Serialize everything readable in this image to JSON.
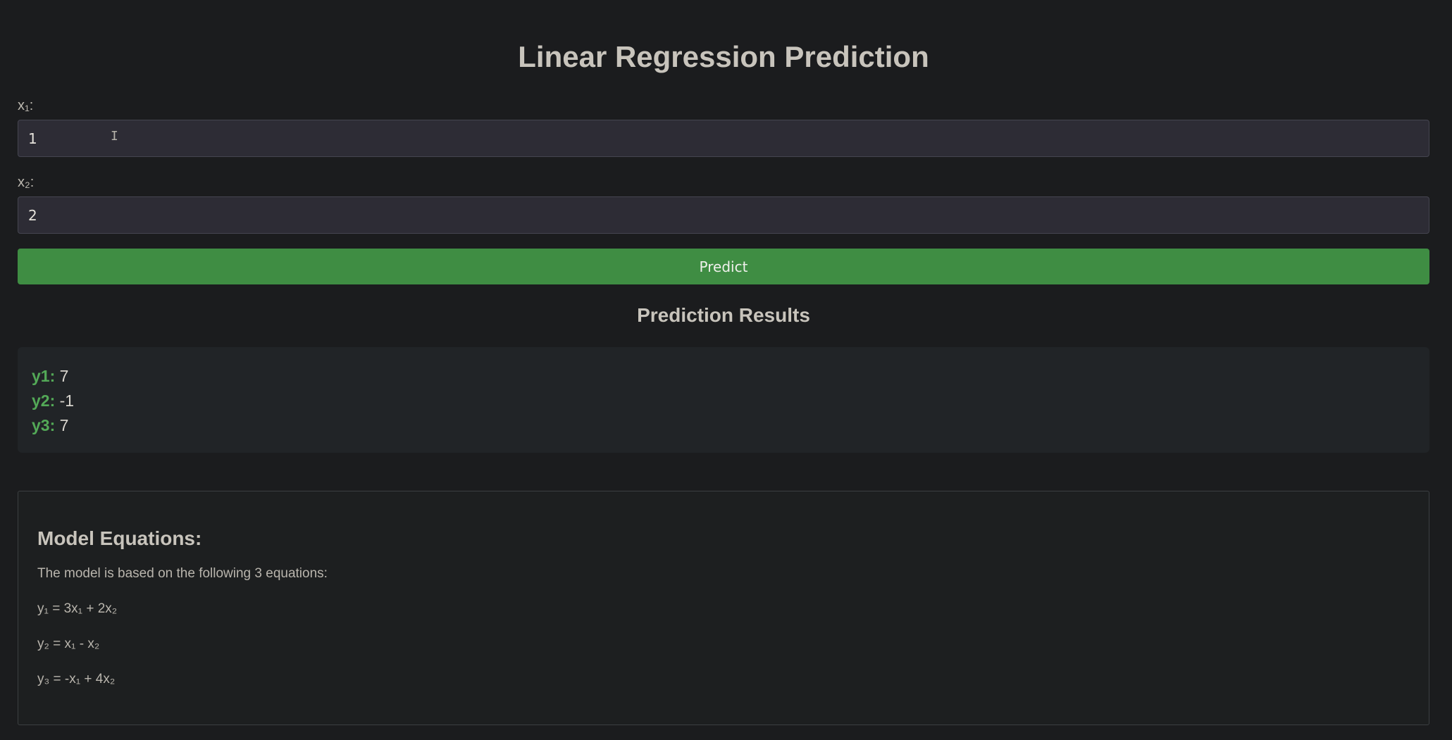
{
  "page": {
    "title": "Linear Regression Prediction"
  },
  "form": {
    "x1_label": "x₁:",
    "x1_value": "1",
    "x2_label": "x₂:",
    "x2_value": "2",
    "predict_label": "Predict"
  },
  "results": {
    "heading": "Prediction Results",
    "items": [
      {
        "key": "y1:",
        "value": "7"
      },
      {
        "key": "y2:",
        "value": "-1"
      },
      {
        "key": "y3:",
        "value": "7"
      }
    ]
  },
  "equations": {
    "heading": "Model Equations:",
    "intro": "The model is based on the following 3 equations:",
    "lines": [
      "y₁ = 3x₁ + 2x₂",
      "y₂ = x₁ - x₂",
      "y₃ = -x₁ + 4x₂"
    ]
  },
  "colors": {
    "background": "#1b1c1e",
    "accent_green": "#3f8d43",
    "result_key_green": "#53a957",
    "input_background": "#2d2c35"
  },
  "icons": {
    "text_cursor": "text-cursor-icon"
  }
}
